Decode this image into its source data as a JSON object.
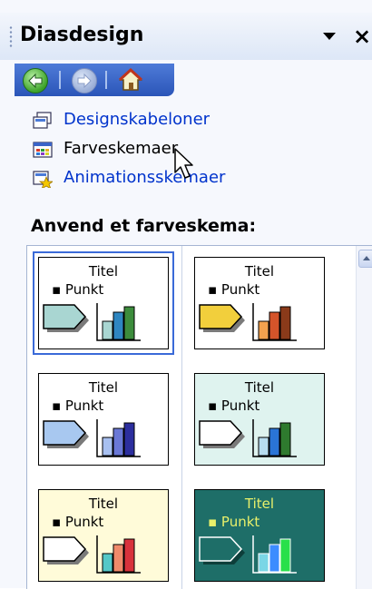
{
  "pane": {
    "title": "Diasdesign"
  },
  "links": [
    {
      "label": "Designskabeloner",
      "icon": "design-templates-icon"
    },
    {
      "label": "Farveskemaer",
      "icon": "color-schemes-icon"
    },
    {
      "label": "Animationsskemaer",
      "icon": "animation-schemes-icon"
    }
  ],
  "section_label": "Anvend et farveskema:",
  "schemes": [
    {
      "title": "Titel",
      "bullet": "Punkt",
      "bg": "#ffffff",
      "text": "#000000",
      "arrow": "#a9d6d2",
      "bars": [
        "#a9d6d2",
        "#2e86c1",
        "#3c8c3c"
      ],
      "selected": true
    },
    {
      "title": "Titel",
      "bullet": "Punkt",
      "bg": "#ffffff",
      "text": "#000000",
      "arrow": "#f2cf3c",
      "bars": [
        "#f4a24e",
        "#d4542a",
        "#8a3a1a"
      ],
      "selected": false
    },
    {
      "title": "Titel",
      "bullet": "Punkt",
      "bg": "#ffffff",
      "text": "#000000",
      "arrow": "#a8c8f0",
      "bars": [
        "#a8c0f0",
        "#6a78d6",
        "#2c2e9e"
      ],
      "selected": false
    },
    {
      "title": "Titel",
      "bullet": "Punkt",
      "bg": "#dff3ef",
      "text": "#000000",
      "arrow": "#ffffff",
      "bars": [
        "#b7dcef",
        "#2a74d6",
        "#2e7a2e"
      ],
      "selected": false
    },
    {
      "title": "Titel",
      "bullet": "Punkt",
      "bg": "#fffbd9",
      "text": "#000000",
      "arrow": "#ffffff",
      "bars": [
        "#54c8c8",
        "#f08a6a",
        "#d8323c"
      ],
      "selected": false
    },
    {
      "title": "Titel",
      "bullet": "Punkt",
      "bg": "#1e6e68",
      "text": "#e8f06a",
      "arrow": "#1e6e68",
      "bars": [
        "#7ad6e6",
        "#3c8cff",
        "#28e04a"
      ],
      "selected": false
    }
  ]
}
